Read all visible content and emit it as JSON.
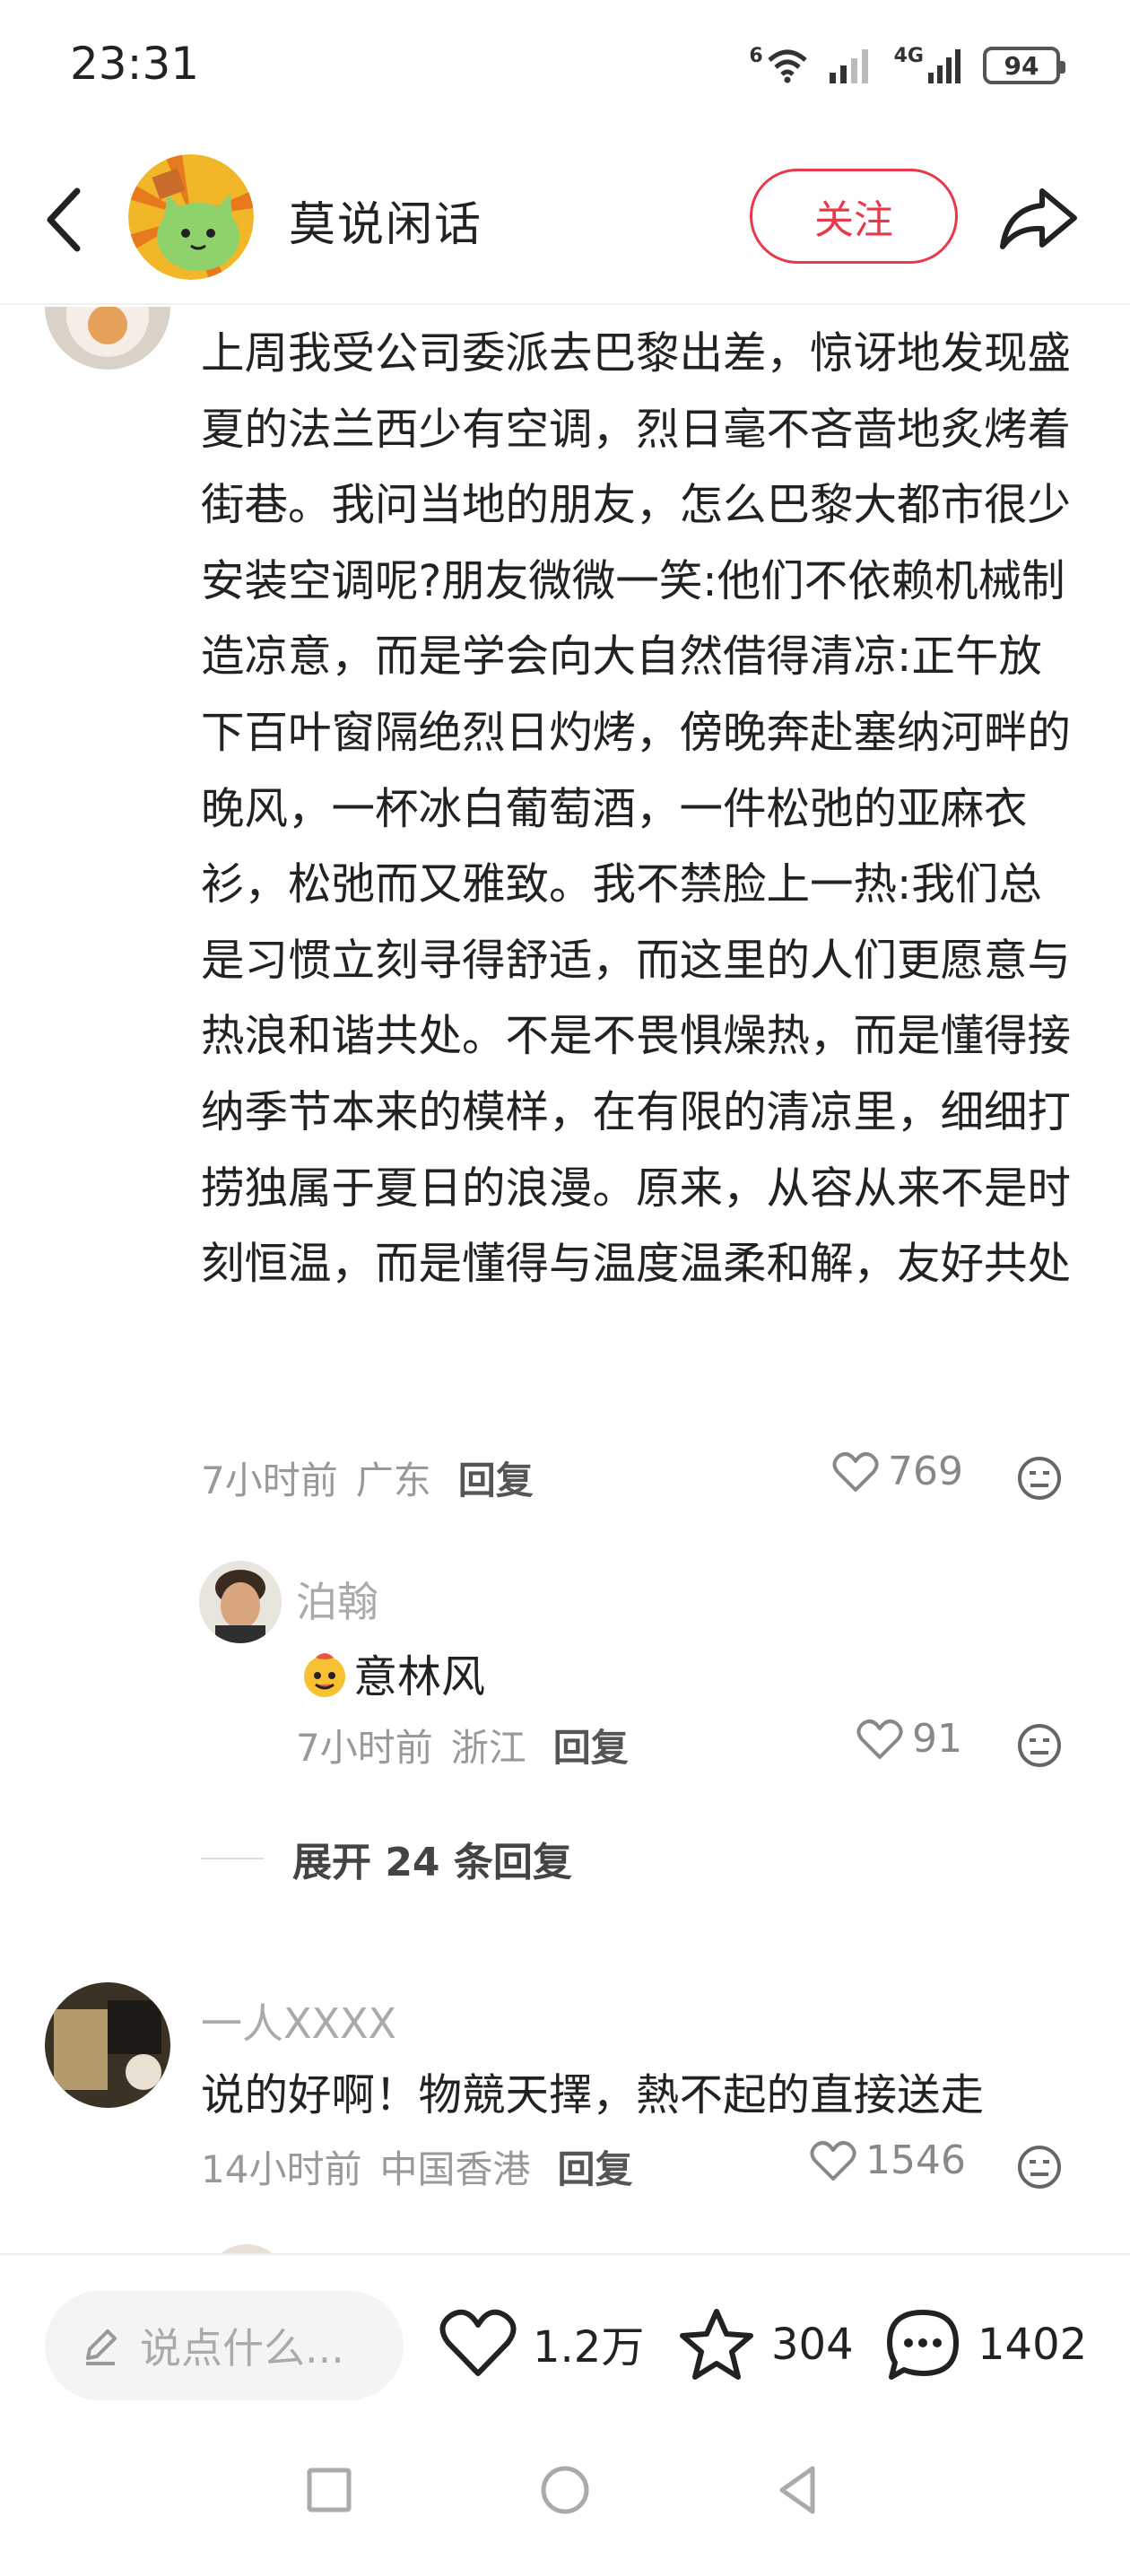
{
  "status_bar": {
    "time": "23:31",
    "network_label": "6",
    "signal_label": "4G",
    "battery": "94"
  },
  "header": {
    "author_name": "莫说闲话",
    "follow_label": "关注",
    "icons": [
      "back-icon",
      "share-icon"
    ]
  },
  "comments": [
    {
      "text": "上周我受公司委派去巴黎出差，惊讶地发现盛夏的法兰西少有空调，烈日毫不吝啬地炙烤着街巷。我问当地的朋友，怎么巴黎大都市很少安装空调呢?朋友微微一笑:他们不依赖机械制造凉意，而是学会向大自然借得清凉:正午放下百叶窗隔绝烈日灼烤，傍晚奔赴塞纳河畔的晚风，一杯冰白葡萄酒，一件松弛的亚麻衣衫，松弛而又雅致。我不禁脸上一热:我们总是习惯立刻寻得舒适，而这里的人们更愿意与热浪和谐共处。不是不畏惧燥热，而是懂得接纳季节本来的模样，在有限的清凉里，细细打捞独属于夏日的浪漫。原来，从容从来不是时刻恒温，而是懂得与温度温柔和解，友好共处",
      "time": "7小时前",
      "location": "广东",
      "reply_label": "回复",
      "likes": "769",
      "reply": {
        "nickname": "泊翰",
        "text": "意林风",
        "time": "7小时前",
        "location": "浙江",
        "reply_label": "回复",
        "likes": "91"
      },
      "expand_label": "展开 24 条回复"
    },
    {
      "nickname": "一人XXXX",
      "text": "说的好啊！物競天擇，熱不起的直接送走",
      "time": "14小时前",
      "location": "中国香港",
      "reply_label": "回复",
      "likes": "1546"
    }
  ],
  "bottom_bar": {
    "input_placeholder": "说点什么...",
    "likes": "1.2万",
    "favorites": "304",
    "comments": "1402"
  },
  "colors": {
    "accent": "#e8394c",
    "secondary_text": "#999999"
  }
}
